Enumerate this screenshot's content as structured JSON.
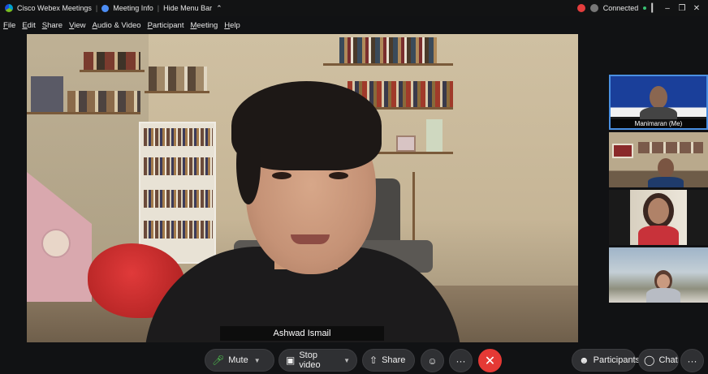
{
  "titlebar": {
    "app_name": "Cisco Webex Meetings",
    "meeting_info": "Meeting Info",
    "hide_menu_bar": "Hide Menu Bar",
    "connection_status": "Connected",
    "minimize_glyph": "–",
    "maximize_glyph": "❒",
    "close_glyph": "✕"
  },
  "menu": [
    "File",
    "Edit",
    "Share",
    "View",
    "Audio & Video",
    "Participant",
    "Meeting",
    "Help"
  ],
  "main_video": {
    "speaker_name": "Ashwad Ismail"
  },
  "thumbnails": [
    {
      "label": "Manimaran  (Me)",
      "active": true
    },
    {
      "label": ""
    },
    {
      "label": ""
    },
    {
      "label": ""
    }
  ],
  "toolbar": {
    "mute_label": "Mute",
    "stop_video_label": "Stop video",
    "share_label": "Share",
    "participants_label": "Participants",
    "chat_label": "Chat",
    "more_glyph": "···",
    "end_glyph": "✕",
    "reactions_glyph": "☺"
  },
  "colors": {
    "accent_blue": "#4a90e2",
    "end_red": "#e53935",
    "connected_green": "#38c172",
    "mic_green": "#4ec34e"
  }
}
